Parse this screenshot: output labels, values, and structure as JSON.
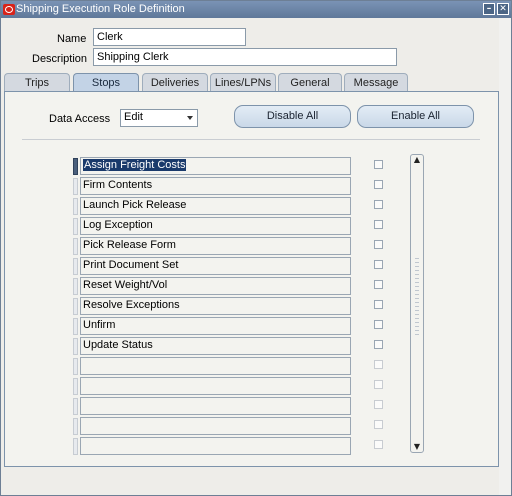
{
  "window": {
    "title": "Shipping Execution Role Definition",
    "controls": [
      "minimize",
      "close"
    ],
    "minimize_glyph": "–",
    "close_glyph": "✕"
  },
  "header": {
    "name_label": "Name",
    "name_value": "Clerk",
    "description_label": "Description",
    "description_value": "Shipping Clerk"
  },
  "tabs": [
    {
      "label": "Trips",
      "active": false
    },
    {
      "label": "Stops",
      "active": true
    },
    {
      "label": "Deliveries",
      "active": false
    },
    {
      "label": "Lines/LPNs",
      "active": false
    },
    {
      "label": "General",
      "active": false
    },
    {
      "label": "Message",
      "active": false
    }
  ],
  "toolbar": {
    "data_access_label": "Data Access",
    "data_access_value": "Edit",
    "disable_all_label": "Disable All",
    "enable_all_label": "Enable All"
  },
  "actions": [
    {
      "name": "Assign Freight Costs",
      "checked": false,
      "selected": true
    },
    {
      "name": "Firm Contents",
      "checked": false
    },
    {
      "name": "Launch Pick Release",
      "checked": false
    },
    {
      "name": "Log Exception",
      "checked": false
    },
    {
      "name": "Pick Release Form",
      "checked": false
    },
    {
      "name": "Print Document Set",
      "checked": false
    },
    {
      "name": "Reset Weight/Vol",
      "checked": false
    },
    {
      "name": "Resolve Exceptions",
      "checked": false
    },
    {
      "name": "Unfirm",
      "checked": false
    },
    {
      "name": "Update Status",
      "checked": false
    },
    {
      "name": "",
      "checked": false
    },
    {
      "name": "",
      "checked": false
    },
    {
      "name": "",
      "checked": false
    },
    {
      "name": "",
      "checked": false
    },
    {
      "name": "",
      "checked": false
    }
  ],
  "scrollbar": {
    "up_glyph": "▲",
    "down_glyph": "▼"
  },
  "colors": {
    "titlebar": "#6a83a6",
    "active_tab": "#c3d3e6",
    "selection": "#1a3a6b"
  }
}
